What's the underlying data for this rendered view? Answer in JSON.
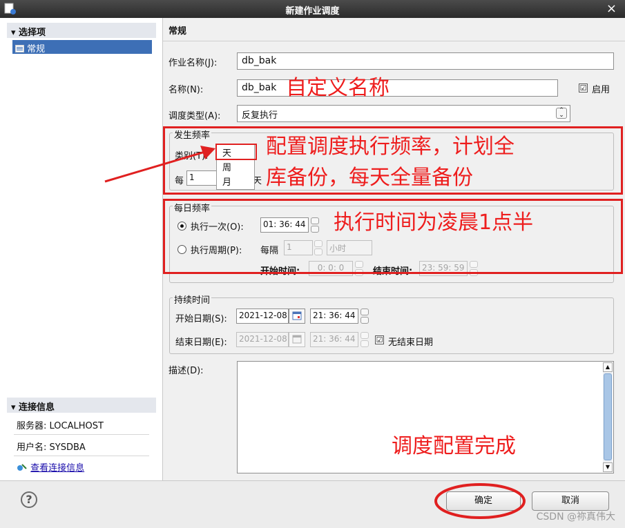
{
  "window": {
    "title": "新建作业调度",
    "close_glyph": "×"
  },
  "sidebar": {
    "header": "▾ 选择项",
    "items": [
      {
        "label": "常规",
        "icon": "list-icon"
      }
    ],
    "connection": {
      "header": "▾ 连接信息",
      "server_label": "服务器: LOCALHOST",
      "user_label": "用户名: SYSDBA",
      "view_link": "查看连接信息"
    }
  },
  "page": {
    "title": "常规",
    "job_name_label": "作业名称(J):",
    "job_name_value": "db_bak",
    "name_label": "名称(N):",
    "name_value": "db_bak",
    "enable_label": "启用",
    "enable_checked": "☑",
    "schedule_type_label": "调度类型(A):",
    "schedule_type_value": "反复执行",
    "frequency": {
      "group_label": "发生频率",
      "category_label": "类别(T):",
      "category_value": "天",
      "options": [
        "天",
        "周",
        "月"
      ],
      "every_label": "每",
      "every_value": "1",
      "day_suffix": "天"
    },
    "daily": {
      "group_label": "每日频率",
      "once_label": "执行一次(O):",
      "once_time": "01: 36: 44",
      "period_label": "执行周期(P):",
      "every_label": "每隔",
      "every_value": "1",
      "unit_value": "小时",
      "start_label": "开始时间:",
      "start_value": "0: 0: 0",
      "end_label": "结束时间:",
      "end_value": "23: 59: 59"
    },
    "duration": {
      "group_label": "持续时间",
      "start_date_label": "开始日期(S):",
      "start_date_value": "2021-12-08",
      "start_time_value": "21: 36: 44",
      "end_date_label": "结束日期(E):",
      "end_date_value": "2021-12-08",
      "end_time_value": "21: 36: 44",
      "no_end_label": "无结束日期",
      "no_end_checked": "☑"
    },
    "description_label": "描述(D):"
  },
  "buttons": {
    "ok": "确定",
    "cancel": "取消",
    "help": "?"
  },
  "annotations": {
    "custom_name": "自定义名称",
    "freq_line1": "配置调度执行频率，计划全",
    "freq_line2": "库备份，每天全量备份",
    "exec_time": "执行时间为凌晨1点半",
    "done": "调度配置完成"
  },
  "watermark": "CSDN @祢真伟大",
  "colors": {
    "annotation_red": "#ee1d1d",
    "selection_blue": "#3d6fb6"
  }
}
